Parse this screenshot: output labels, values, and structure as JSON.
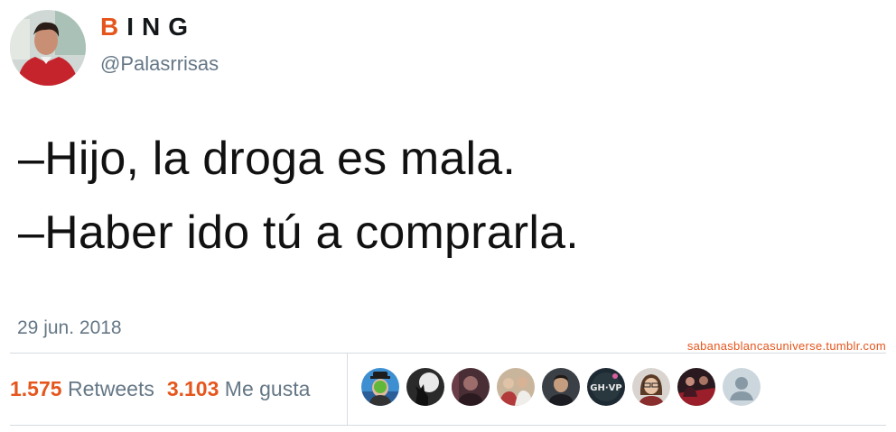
{
  "profile": {
    "name_first_letter": "B",
    "name_rest": "ING",
    "handle": "@Palasrrisas",
    "accent_color": "#e5561d"
  },
  "tweet": {
    "lines": [
      "–Hijo, la droga es mala.",
      "–Haber ido tú a comprarla."
    ],
    "date": "29 jun. 2018"
  },
  "watermark": "sabanasblancasuniverse.tumblr.com",
  "stats": {
    "retweets_count": "1.575",
    "retweets_label": "Retweets",
    "likes_count": "3.103",
    "likes_label": "Me gusta"
  },
  "likers": [
    {
      "icon": "magritte-apple-avatar"
    },
    {
      "icon": "howling-wolf-avatar"
    },
    {
      "icon": "dark-portrait-avatar"
    },
    {
      "icon": "group-photo-avatar"
    },
    {
      "icon": "man-portrait-avatar"
    },
    {
      "icon": "gh-vip-logo-avatar"
    },
    {
      "icon": "woman-glasses-avatar"
    },
    {
      "icon": "red-scene-avatar"
    },
    {
      "icon": "default-user-avatar"
    }
  ]
}
